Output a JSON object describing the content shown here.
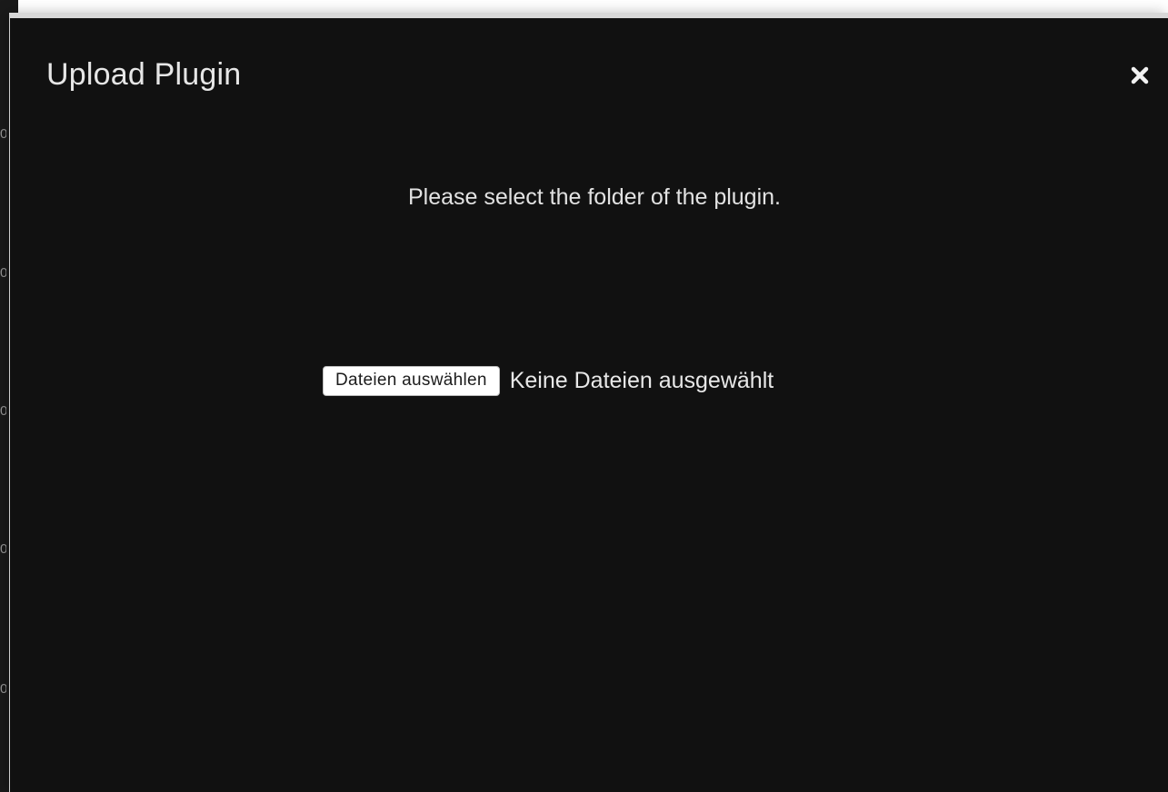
{
  "modal": {
    "title": "Upload Plugin",
    "close_icon": "close-icon",
    "instruction": "Please select the folder of the plugin.",
    "file_input": {
      "button_label": "Dateien auswählen",
      "status_text": "Keine Dateien ausgewählt"
    }
  },
  "background": {
    "tick_labels": [
      "0",
      "0",
      "0",
      "0",
      "0"
    ]
  },
  "colors": {
    "modal_background": "#111111",
    "text": "#e6e6e6",
    "marker": "#6cf24a"
  }
}
